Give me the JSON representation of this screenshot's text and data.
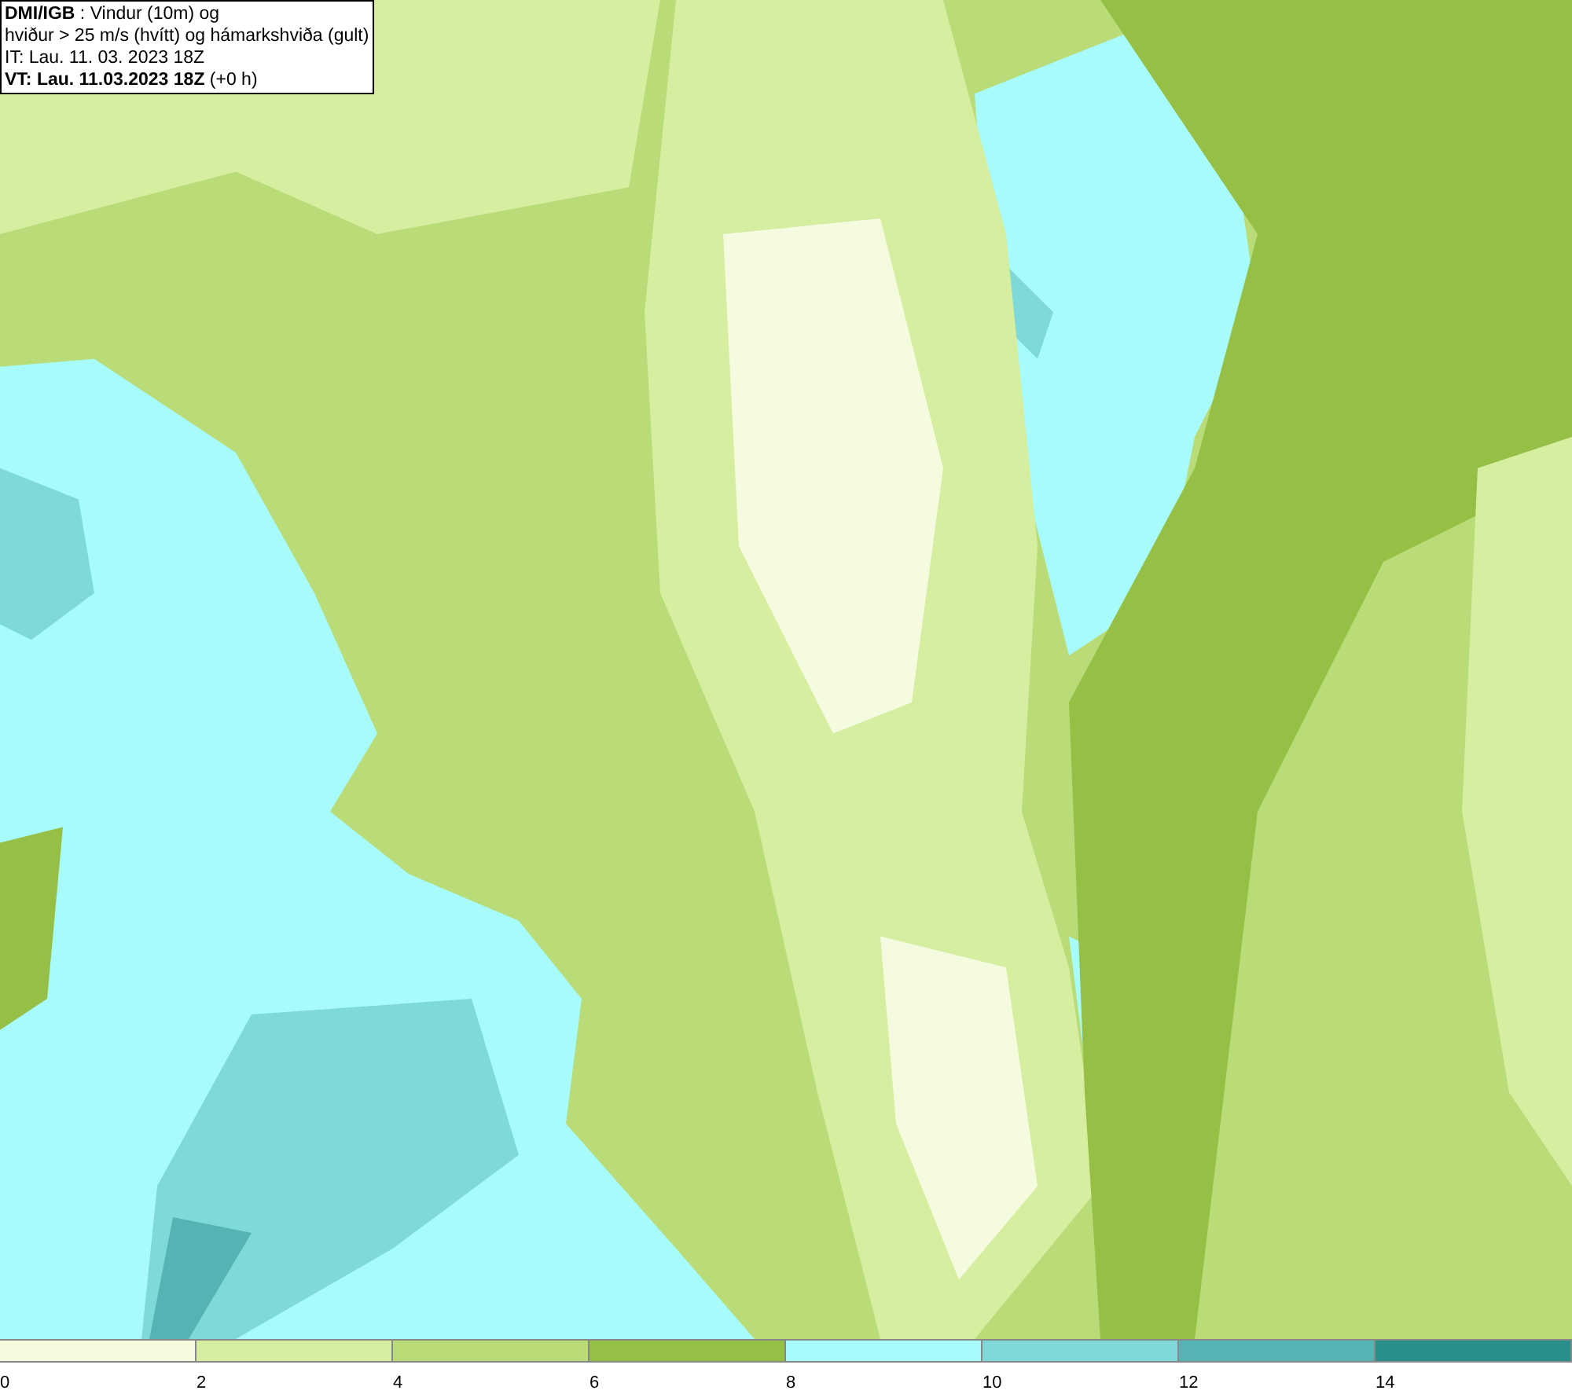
{
  "header": {
    "lines": [
      "**DMI/IGB** : Vindur (10m) og",
      "hviður > 25 m/s (hvítt) og hámarkshviða (gult)",
      "IT: Lau. 11. 03. 2023 18Z",
      "**VT: Lau. 11.03.2023 18Z** (+0 h)"
    ]
  },
  "legend": [
    {
      "label": "0",
      "color": "#f5fbdf"
    },
    {
      "label": "2",
      "color": "#d6eea0"
    },
    {
      "label": "4",
      "color": "#b9dc78"
    },
    {
      "label": "6",
      "color": "#96bf45"
    },
    {
      "label": "8",
      "color": "#a8fbfb"
    },
    {
      "label": "10",
      "color": "#7fd9d9"
    },
    {
      "label": "12",
      "color": "#55b3b3"
    },
    {
      "label": "14",
      "color": "#2a8f8a"
    }
  ]
}
